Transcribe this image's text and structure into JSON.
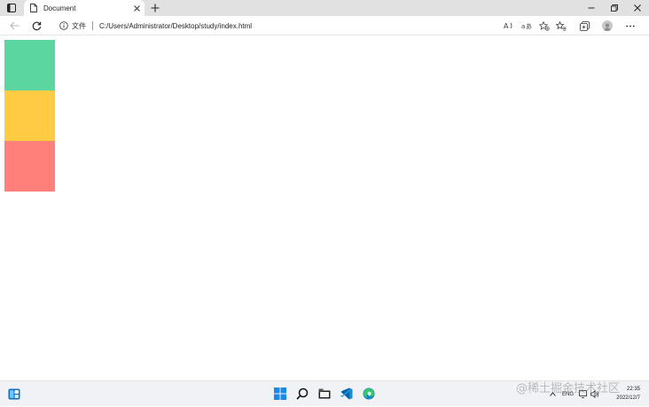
{
  "browser": {
    "tab_title": "Document",
    "address_scheme_label": "文件",
    "url": "C:/Users/Administrator/Desktop/study/index.html",
    "icons": {
      "tab_actions": "tab-actions-icon",
      "document": "document-icon",
      "close_tab": "close-icon",
      "new_tab": "plus-icon",
      "minimize": "minimize-icon",
      "restore": "restore-icon",
      "close_window": "close-icon",
      "back": "back-arrow-icon",
      "refresh": "refresh-icon",
      "info": "info-icon",
      "read_aloud": "read-aloud-icon",
      "translate": "translate-icon",
      "add_favorite": "star-plus-icon",
      "favorites": "favorites-icon",
      "collections": "collections-icon",
      "profile": "avatar",
      "more": "more-icon"
    }
  },
  "page": {
    "blocks": [
      {
        "name": "green-block",
        "color": "#5bd6a0"
      },
      {
        "name": "yellow-block",
        "color": "#ffcb43"
      },
      {
        "name": "red-block",
        "color": "#ff7f7a"
      }
    ]
  },
  "taskbar": {
    "language": "ENG",
    "time": "22:35",
    "date": "2022/12/7",
    "icons": [
      "widgets-icon",
      "windows-start-icon",
      "search-icon",
      "file-explorer-icon",
      "vscode-icon",
      "edge-icon",
      "chevron-up-icon",
      "network-icon",
      "volume-icon"
    ]
  },
  "watermark": "@稀土掘金技术社区"
}
